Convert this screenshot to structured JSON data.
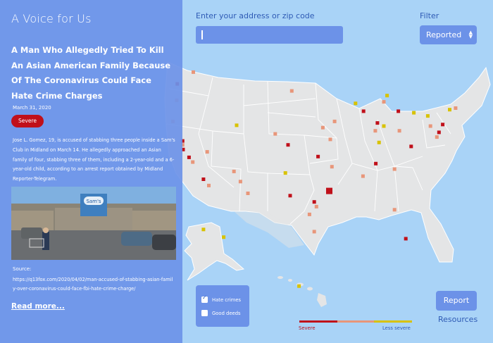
{
  "app": {
    "title": "A Voice for Us"
  },
  "article": {
    "headline": "A Man Who Allegedly Tried To Kill An Asian American Family Because Of The Coronavirus Could Face Hate Crime Charges",
    "date": "March 31, 2020",
    "severity": "Severe",
    "summary": "Jose L. Gomez, 19, is accused of stabbing three people inside a Sam's Club in Midland on March 14. He allegedly approached an Asian family of four, stabbing three of them, including a 2-year-old and a 6-year-old child, according to an arrest report obtained by Midland Reporter-Telegram.",
    "image_sign_text": "Sam's",
    "source_label": "Source:",
    "source_url": "https://q13fox.com/2020/04/02/man-accused-of-stabbing-asian-family-over-coronavirus-could-face-fbi-hate-crime-charge/",
    "read_more": "Read more..."
  },
  "search": {
    "label": "Enter your address or zip code",
    "placeholder": "",
    "value": ""
  },
  "filter": {
    "label": "Filter",
    "selected": "Reported"
  },
  "toggles": [
    {
      "label": "Hate crimes",
      "checked": true
    },
    {
      "label": "Good deeds",
      "checked": false
    }
  ],
  "legend": {
    "severe_label": "Severe",
    "less_label": "Less severe",
    "colors": [
      "#c0101a",
      "#e8967a",
      "#d8c200"
    ]
  },
  "actions": {
    "report": "Report",
    "resources": "Resources"
  },
  "incidents": [
    {
      "lat": 47.7,
      "lon": -120.2,
      "severity": "medium"
    },
    {
      "lat": 46.2,
      "lon": -123.2,
      "severity": "high"
    },
    {
      "lat": 44.1,
      "lon": -123.3,
      "severity": "medium"
    },
    {
      "lat": 41.4,
      "lon": -124.0,
      "severity": "medium"
    },
    {
      "lat": 38.9,
      "lon": -122.2,
      "severity": "high"
    },
    {
      "lat": 38.4,
      "lon": -122.2,
      "severity": "medium"
    },
    {
      "lat": 37.8,
      "lon": -122.1,
      "severity": "high"
    },
    {
      "lat": 36.8,
      "lon": -121.0,
      "severity": "high"
    },
    {
      "lat": 36.2,
      "lon": -120.3,
      "severity": "medium"
    },
    {
      "lat": 34.0,
      "lon": -118.3,
      "severity": "high"
    },
    {
      "lat": 33.2,
      "lon": -117.3,
      "severity": "medium"
    },
    {
      "lat": 37.5,
      "lon": -117.6,
      "severity": "medium"
    },
    {
      "lat": 40.9,
      "lon": -112.1,
      "severity": "low"
    },
    {
      "lat": 35.0,
      "lon": -112.6,
      "severity": "medium"
    },
    {
      "lat": 33.7,
      "lon": -111.4,
      "severity": "medium"
    },
    {
      "lat": 32.2,
      "lon": -110.0,
      "severity": "medium"
    },
    {
      "lat": 45.3,
      "lon": -101.8,
      "severity": "medium"
    },
    {
      "lat": 39.8,
      "lon": -104.9,
      "severity": "medium"
    },
    {
      "lat": 38.4,
      "lon": -102.5,
      "severity": "high"
    },
    {
      "lat": 34.8,
      "lon": -103.0,
      "severity": "low"
    },
    {
      "lat": 36.9,
      "lon": -96.9,
      "severity": "high"
    },
    {
      "lat": 35.6,
      "lon": -94.3,
      "severity": "medium"
    },
    {
      "lat": 39.1,
      "lon": -94.6,
      "severity": "medium"
    },
    {
      "lat": 40.6,
      "lon": -96.0,
      "severity": "medium"
    },
    {
      "lat": 41.4,
      "lon": -93.8,
      "severity": "medium"
    },
    {
      "lat": 32.5,
      "lon": -94.8,
      "severity": "high",
      "size": "large"
    },
    {
      "lat": 31.1,
      "lon": -97.6,
      "severity": "high"
    },
    {
      "lat": 30.5,
      "lon": -97.2,
      "severity": "medium"
    },
    {
      "lat": 29.5,
      "lon": -98.5,
      "severity": "medium"
    },
    {
      "lat": 27.3,
      "lon": -97.6,
      "severity": "medium"
    },
    {
      "lat": 31.9,
      "lon": -102.1,
      "severity": "high"
    },
    {
      "lat": 43.7,
      "lon": -89.9,
      "severity": "low"
    },
    {
      "lat": 42.7,
      "lon": -88.4,
      "severity": "high"
    },
    {
      "lat": 43.9,
      "lon": -84.6,
      "severity": "medium"
    },
    {
      "lat": 44.7,
      "lon": -84.0,
      "severity": "low"
    },
    {
      "lat": 42.7,
      "lon": -81.9,
      "severity": "high"
    },
    {
      "lat": 41.2,
      "lon": -85.8,
      "severity": "high"
    },
    {
      "lat": 40.8,
      "lon": -84.6,
      "severity": "low"
    },
    {
      "lat": 40.2,
      "lon": -81.7,
      "severity": "medium"
    },
    {
      "lat": 40.2,
      "lon": -86.2,
      "severity": "medium"
    },
    {
      "lat": 38.7,
      "lon": -85.5,
      "severity": "low"
    },
    {
      "lat": 36.0,
      "lon": -86.1,
      "severity": "high"
    },
    {
      "lat": 34.4,
      "lon": -88.5,
      "severity": "medium"
    },
    {
      "lat": 35.3,
      "lon": -82.6,
      "severity": "medium"
    },
    {
      "lat": 38.2,
      "lon": -79.5,
      "severity": "high"
    },
    {
      "lat": 42.5,
      "lon": -79.0,
      "severity": "low"
    },
    {
      "lat": 42.1,
      "lon": -76.4,
      "severity": "low"
    },
    {
      "lat": 41.0,
      "lon": -73.6,
      "severity": "high"
    },
    {
      "lat": 40.0,
      "lon": -74.3,
      "severity": "high"
    },
    {
      "lat": 39.4,
      "lon": -74.7,
      "severity": "medium"
    },
    {
      "lat": 40.8,
      "lon": -75.9,
      "severity": "medium"
    },
    {
      "lat": 42.9,
      "lon": -72.3,
      "severity": "low"
    },
    {
      "lat": 43.1,
      "lon": -71.2,
      "severity": "medium"
    },
    {
      "lat": 30.1,
      "lon": -82.6,
      "severity": "medium"
    },
    {
      "lat": 26.4,
      "lon": -80.5,
      "severity": "high"
    },
    {
      "lat": 60.5,
      "lon": -156.5,
      "severity": "low"
    },
    {
      "lat": 58.4,
      "lon": -136.0,
      "severity": "low"
    },
    {
      "lat": 21.3,
      "lon": -157.9,
      "severity": "low"
    }
  ]
}
